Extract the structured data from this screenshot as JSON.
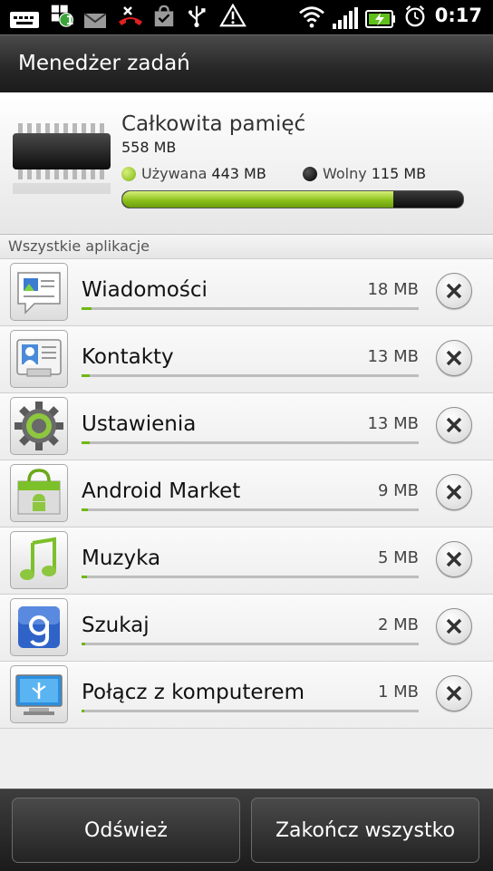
{
  "status_bar": {
    "time": "0:17",
    "notification_badge": "1",
    "icons": [
      "keyboard-icon",
      "usb-debug-icon",
      "mail-icon",
      "missed-call-icon",
      "market-bag-icon",
      "usb-icon",
      "warning-icon",
      "wifi-icon",
      "signal-icon",
      "battery-charging-icon",
      "alarm-icon"
    ]
  },
  "title": "Menedżer zadań",
  "memory": {
    "title": "Całkowita pamięć",
    "total": "558 MB",
    "used_label": "Używana",
    "used_value": "443 MB",
    "free_label": "Wolny",
    "free_value": "115 MB",
    "used_fraction": 0.794,
    "used_color": "#8cc21b",
    "free_color": "#1a1a1a"
  },
  "section_header": "Wszystkie aplikacje",
  "apps": [
    {
      "name": "Wiadomości",
      "size": "18 MB",
      "icon": "messages-icon",
      "fraction": 0.03
    },
    {
      "name": "Kontakty",
      "size": "13 MB",
      "icon": "contacts-icon",
      "fraction": 0.025
    },
    {
      "name": "Ustawienia",
      "size": "13 MB",
      "icon": "settings-gear-icon",
      "fraction": 0.025
    },
    {
      "name": "Android Market",
      "size": "9 MB",
      "icon": "android-market-icon",
      "fraction": 0.02
    },
    {
      "name": "Muzyka",
      "size": "5 MB",
      "icon": "music-note-icon",
      "fraction": 0.015
    },
    {
      "name": "Szukaj",
      "size": "2 MB",
      "icon": "google-search-icon",
      "fraction": 0.01
    },
    {
      "name": "Połącz z komputerem",
      "size": "1 MB",
      "icon": "connect-pc-icon",
      "fraction": 0.008
    }
  ],
  "buttons": {
    "refresh": "Odśwież",
    "end_all": "Zakończ wszystko"
  },
  "colors": {
    "accent_green": "#6fb814",
    "title_bar": "#262626"
  }
}
